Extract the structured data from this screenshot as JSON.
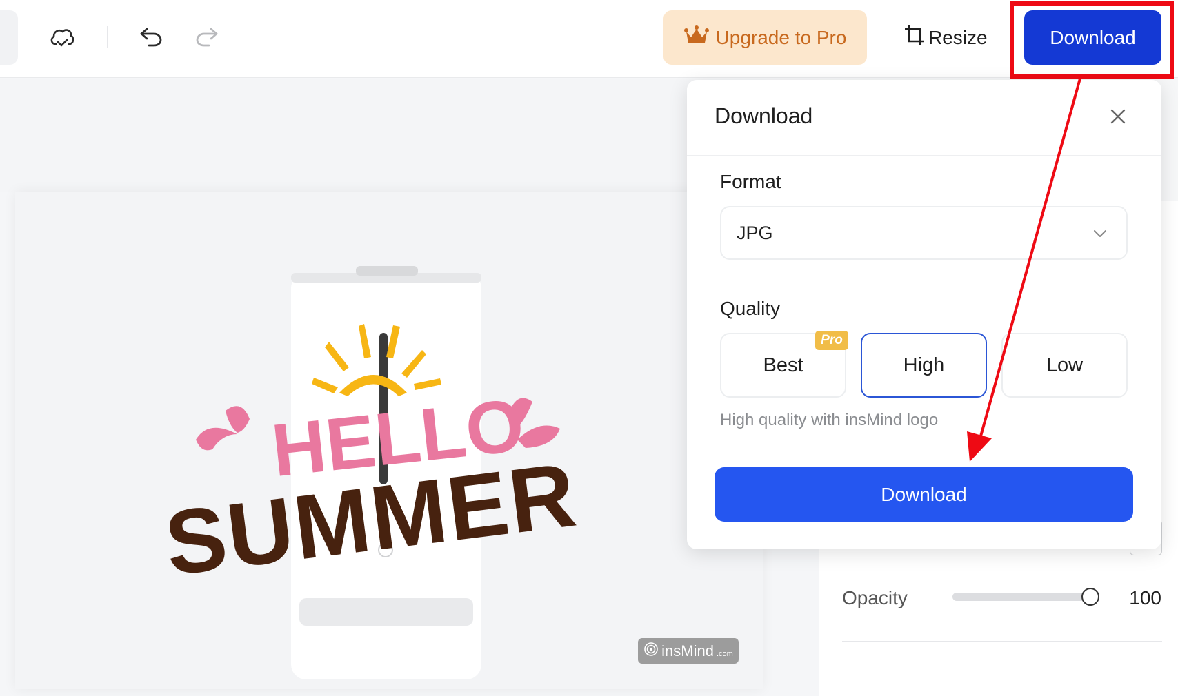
{
  "header": {
    "upgrade_label": "Upgrade to Pro",
    "resize_label": "Resize",
    "download_label": "Download",
    "icons": [
      "cloud-saved-icon",
      "undo-icon",
      "redo-icon",
      "crown-icon",
      "crop-icon"
    ]
  },
  "canvas": {
    "design_text_line1": "HELLO",
    "design_text_line2": "SUMMER",
    "watermark_brand": "insMind",
    "watermark_suffix": ".com"
  },
  "download_popup": {
    "title": "Download",
    "format_label": "Format",
    "format_value": "JPG",
    "quality_label": "Quality",
    "quality_options": [
      {
        "label": "Best",
        "badge": "Pro",
        "selected": false
      },
      {
        "label": "High",
        "selected": true
      },
      {
        "label": "Low",
        "selected": false
      }
    ],
    "quality_help": "High quality with insMind logo",
    "download_label": "Download"
  },
  "properties": {
    "opacity_label": "Opacity",
    "opacity_value": "100",
    "opacity_fraction": 1.0
  },
  "colors": {
    "primary_blue": "#2556f0",
    "header_download_blue": "#1439d4",
    "upgrade_bg": "#fce7cd",
    "upgrade_text": "#c8691e",
    "pro_badge": "#f1bd48",
    "annotation_red": "#ee0a14",
    "hello_pink": "#e9789f",
    "summer_brown": "#47220f",
    "sun_yellow": "#f7b614"
  }
}
